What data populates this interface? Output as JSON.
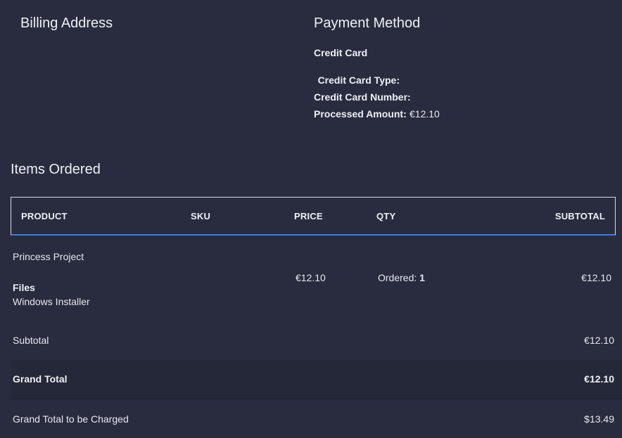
{
  "billing": {
    "title": "Billing Address"
  },
  "payment": {
    "title": "Payment Method",
    "method": "Credit Card",
    "card_type_label": "Credit Card Type:",
    "card_type_value": "",
    "card_number_label": "Credit Card Number:",
    "card_number_value": "",
    "processed_label": "Processed Amount:",
    "processed_value": "€12.10"
  },
  "items": {
    "title": "Items Ordered",
    "columns": {
      "product": "PRODUCT",
      "sku": "SKU",
      "price": "PRICE",
      "qty": "QTY",
      "subtotal": "SUBTOTAL"
    },
    "rows": [
      {
        "product": "Princess Project",
        "files_label": "Files",
        "file_name": "Windows Installer",
        "sku": "",
        "price": "€12.10",
        "qty_label": "Ordered:",
        "qty_value": "1",
        "subtotal": "€12.10"
      }
    ]
  },
  "totals": {
    "subtotal_label": "Subtotal",
    "subtotal_value": "€12.10",
    "grand_total_label": "Grand Total",
    "grand_total_value": "€12.10",
    "charged_label": "Grand Total to be Charged",
    "charged_value": "$13.49"
  },
  "colors": {
    "background": "#292c3f",
    "band": "#252838",
    "accent_border": "#3b7ddd"
  }
}
